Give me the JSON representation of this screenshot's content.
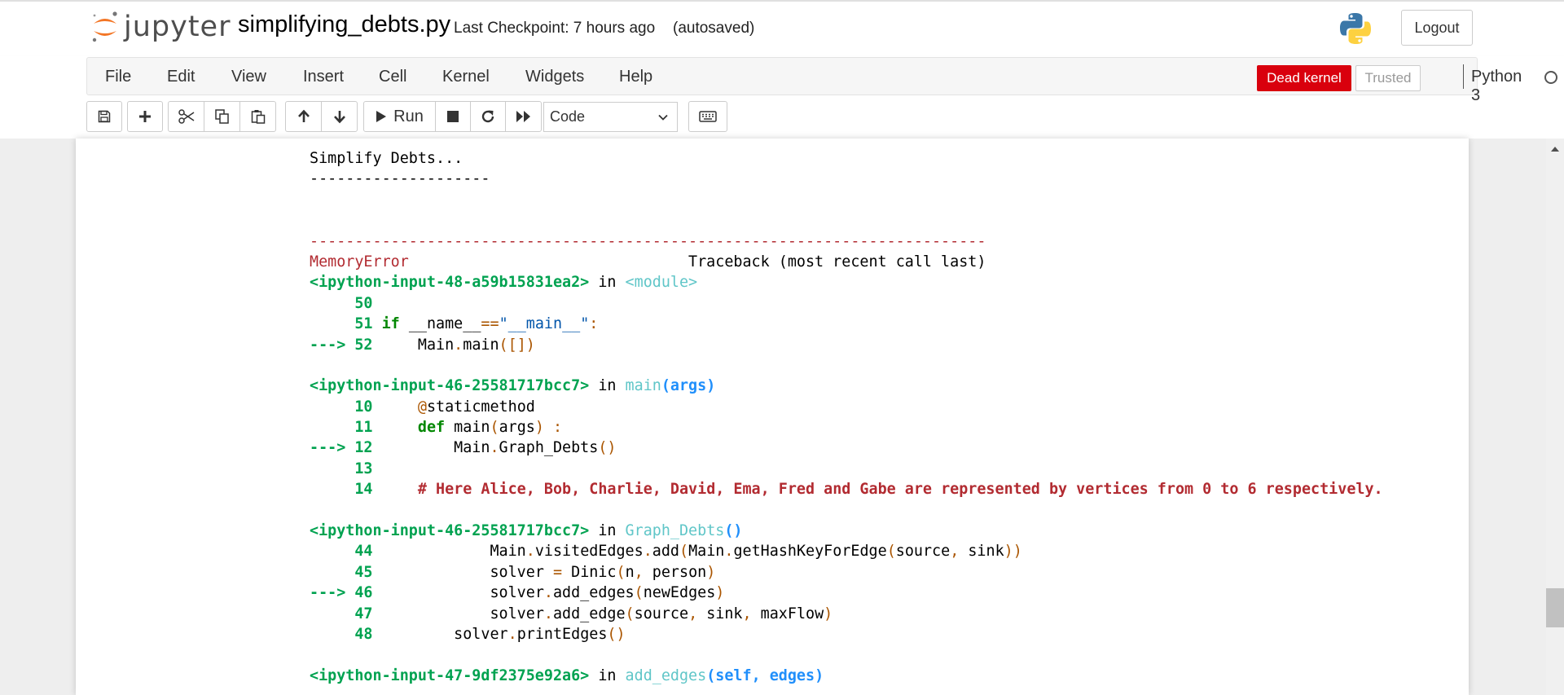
{
  "header": {
    "logo_text": "jupyter",
    "notebook_name": "simplifying_debts.py",
    "checkpoint": "Last Checkpoint: 7 hours ago",
    "autosave_status": "(autosaved)",
    "logout_label": "Logout"
  },
  "menu": {
    "file": "File",
    "edit": "Edit",
    "view": "View",
    "insert": "Insert",
    "cell": "Cell",
    "kernel": "Kernel",
    "widgets": "Widgets",
    "help": "Help"
  },
  "status": {
    "dead_kernel": "Dead kernel",
    "trusted": "Trusted",
    "kernel_name": "Python 3"
  },
  "toolbar": {
    "run_label": "Run",
    "cell_type": "Code"
  },
  "output": {
    "lines": [
      {
        "segments": [
          {
            "text": "Simplify Debts...",
            "cls": ""
          }
        ]
      },
      {
        "segments": [
          {
            "text": "--------------------",
            "cls": ""
          }
        ]
      },
      {
        "segments": [
          {
            "text": "",
            "cls": ""
          }
        ]
      },
      {
        "segments": [
          {
            "text": "",
            "cls": ""
          }
        ]
      },
      {
        "segments": [
          {
            "text": "---------------------------------------------------------------------------",
            "cls": "c-red"
          }
        ]
      },
      {
        "segments": [
          {
            "text": "MemoryError",
            "cls": "c-red"
          },
          {
            "text": "                               Traceback (most recent call last)",
            "cls": ""
          }
        ]
      },
      {
        "segments": [
          {
            "text": "<ipython-input-48-a59b15831ea2>",
            "cls": "c-green"
          },
          {
            "text": " in ",
            "cls": ""
          },
          {
            "text": "<module>",
            "cls": "c-cyan"
          }
        ]
      },
      {
        "segments": [
          {
            "text": "     50",
            "cls": "c-green"
          }
        ]
      },
      {
        "segments": [
          {
            "text": "     51",
            "cls": "c-green"
          },
          {
            "text": " ",
            "cls": ""
          },
          {
            "text": "if",
            "cls": "c-kw"
          },
          {
            "text": " __name__",
            "cls": ""
          },
          {
            "text": "==",
            "cls": "c-op"
          },
          {
            "text": "\"__main__\"",
            "cls": "c-str"
          },
          {
            "text": ":",
            "cls": "c-op"
          }
        ]
      },
      {
        "segments": [
          {
            "text": "---> 52",
            "cls": "c-green"
          },
          {
            "text": "     Main",
            "cls": ""
          },
          {
            "text": ".",
            "cls": "c-op"
          },
          {
            "text": "main",
            "cls": ""
          },
          {
            "text": "([])",
            "cls": "c-op"
          }
        ]
      },
      {
        "segments": [
          {
            "text": "",
            "cls": ""
          }
        ]
      },
      {
        "segments": [
          {
            "text": "<ipython-input-46-25581717bcc7>",
            "cls": "c-green"
          },
          {
            "text": " in ",
            "cls": ""
          },
          {
            "text": "main",
            "cls": "c-cyan"
          },
          {
            "text": "(args)",
            "cls": "c-blue"
          }
        ]
      },
      {
        "segments": [
          {
            "text": "     10",
            "cls": "c-green"
          },
          {
            "text": "     ",
            "cls": ""
          },
          {
            "text": "@",
            "cls": "c-op"
          },
          {
            "text": "staticmethod",
            "cls": ""
          }
        ]
      },
      {
        "segments": [
          {
            "text": "     11",
            "cls": "c-green"
          },
          {
            "text": "     ",
            "cls": ""
          },
          {
            "text": "def",
            "cls": "c-kw"
          },
          {
            "text": " main",
            "cls": ""
          },
          {
            "text": "(",
            "cls": "c-op"
          },
          {
            "text": "args",
            "cls": ""
          },
          {
            "text": ")",
            "cls": "c-op"
          },
          {
            "text": " ",
            "cls": ""
          },
          {
            "text": ":",
            "cls": "c-op"
          }
        ]
      },
      {
        "segments": [
          {
            "text": "---> 12",
            "cls": "c-green"
          },
          {
            "text": "         Main",
            "cls": ""
          },
          {
            "text": ".",
            "cls": "c-op"
          },
          {
            "text": "Graph_Debts",
            "cls": ""
          },
          {
            "text": "()",
            "cls": "c-op"
          }
        ]
      },
      {
        "segments": [
          {
            "text": "     13",
            "cls": "c-green"
          }
        ]
      },
      {
        "segments": [
          {
            "text": "     14",
            "cls": "c-green"
          },
          {
            "text": "     ",
            "cls": ""
          },
          {
            "text": "# Here Alice, Bob, Charlie, David, Ema, Fred and Gabe are represented by vertices from 0 to 6 respectively.",
            "cls": "c-comment"
          }
        ]
      },
      {
        "segments": [
          {
            "text": "",
            "cls": ""
          }
        ]
      },
      {
        "segments": [
          {
            "text": "<ipython-input-46-25581717bcc7>",
            "cls": "c-green"
          },
          {
            "text": " in ",
            "cls": ""
          },
          {
            "text": "Graph_Debts",
            "cls": "c-cyan"
          },
          {
            "text": "()",
            "cls": "c-blue"
          }
        ]
      },
      {
        "segments": [
          {
            "text": "     44",
            "cls": "c-green"
          },
          {
            "text": "             Main",
            "cls": ""
          },
          {
            "text": ".",
            "cls": "c-op"
          },
          {
            "text": "visitedEdges",
            "cls": ""
          },
          {
            "text": ".",
            "cls": "c-op"
          },
          {
            "text": "add",
            "cls": ""
          },
          {
            "text": "(",
            "cls": "c-op"
          },
          {
            "text": "Main",
            "cls": ""
          },
          {
            "text": ".",
            "cls": "c-op"
          },
          {
            "text": "getHashKeyForEdge",
            "cls": ""
          },
          {
            "text": "(",
            "cls": "c-op"
          },
          {
            "text": "source",
            "cls": ""
          },
          {
            "text": ",",
            "cls": "c-op"
          },
          {
            "text": " sink",
            "cls": ""
          },
          {
            "text": "))",
            "cls": "c-op"
          }
        ]
      },
      {
        "segments": [
          {
            "text": "     45",
            "cls": "c-green"
          },
          {
            "text": "             solver ",
            "cls": ""
          },
          {
            "text": "=",
            "cls": "c-op"
          },
          {
            "text": " Dinic",
            "cls": ""
          },
          {
            "text": "(",
            "cls": "c-op"
          },
          {
            "text": "n",
            "cls": ""
          },
          {
            "text": ",",
            "cls": "c-op"
          },
          {
            "text": " person",
            "cls": ""
          },
          {
            "text": ")",
            "cls": "c-op"
          }
        ]
      },
      {
        "segments": [
          {
            "text": "---> 46",
            "cls": "c-green"
          },
          {
            "text": "             solver",
            "cls": ""
          },
          {
            "text": ".",
            "cls": "c-op"
          },
          {
            "text": "add_edges",
            "cls": ""
          },
          {
            "text": "(",
            "cls": "c-op"
          },
          {
            "text": "newEdges",
            "cls": ""
          },
          {
            "text": ")",
            "cls": "c-op"
          }
        ]
      },
      {
        "segments": [
          {
            "text": "     47",
            "cls": "c-green"
          },
          {
            "text": "             solver",
            "cls": ""
          },
          {
            "text": ".",
            "cls": "c-op"
          },
          {
            "text": "add_edge",
            "cls": ""
          },
          {
            "text": "(",
            "cls": "c-op"
          },
          {
            "text": "source",
            "cls": ""
          },
          {
            "text": ",",
            "cls": "c-op"
          },
          {
            "text": " sink",
            "cls": ""
          },
          {
            "text": ",",
            "cls": "c-op"
          },
          {
            "text": " maxFlow",
            "cls": ""
          },
          {
            "text": ")",
            "cls": "c-op"
          }
        ]
      },
      {
        "segments": [
          {
            "text": "     48",
            "cls": "c-green"
          },
          {
            "text": "         solver",
            "cls": ""
          },
          {
            "text": ".",
            "cls": "c-op"
          },
          {
            "text": "printEdges",
            "cls": ""
          },
          {
            "text": "()",
            "cls": "c-op"
          }
        ]
      },
      {
        "segments": [
          {
            "text": "",
            "cls": ""
          }
        ]
      },
      {
        "segments": [
          {
            "text": "<ipython-input-47-9df2375e92a6>",
            "cls": "c-green"
          },
          {
            "text": " in ",
            "cls": ""
          },
          {
            "text": "add_edges",
            "cls": "c-cyan"
          },
          {
            "text": "(self, edges)",
            "cls": "c-blue"
          }
        ]
      }
    ]
  },
  "colors": {
    "dead_kernel_bg": "#d9000d",
    "jupyter_orange": "#f37626",
    "traceback_red": "#b22b31",
    "lineno_green": "#00a250"
  }
}
